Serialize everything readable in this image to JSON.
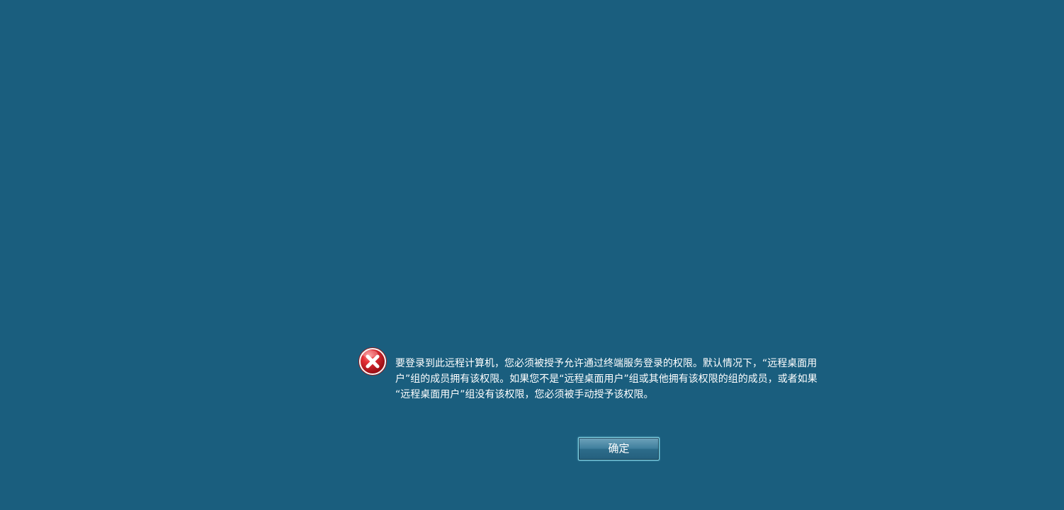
{
  "dialog": {
    "icon": "error-icon",
    "message_lines": [
      "要登录到此远程计算机，您必须被授予允许通过终端服务登录的权限。默认情况下，“远程桌面用",
      "户”组的成员拥有该权限。如果您不是“远程桌面用户”组或其他拥有该权限的组的成员，或者如果",
      "“远程桌面用户”组没有该权限，您必须被手动授予该权限。"
    ],
    "ok_label": "确定"
  },
  "colors": {
    "background": "#1a5e7e",
    "error_red": "#d9232d",
    "button_border": "#86d9ea"
  }
}
